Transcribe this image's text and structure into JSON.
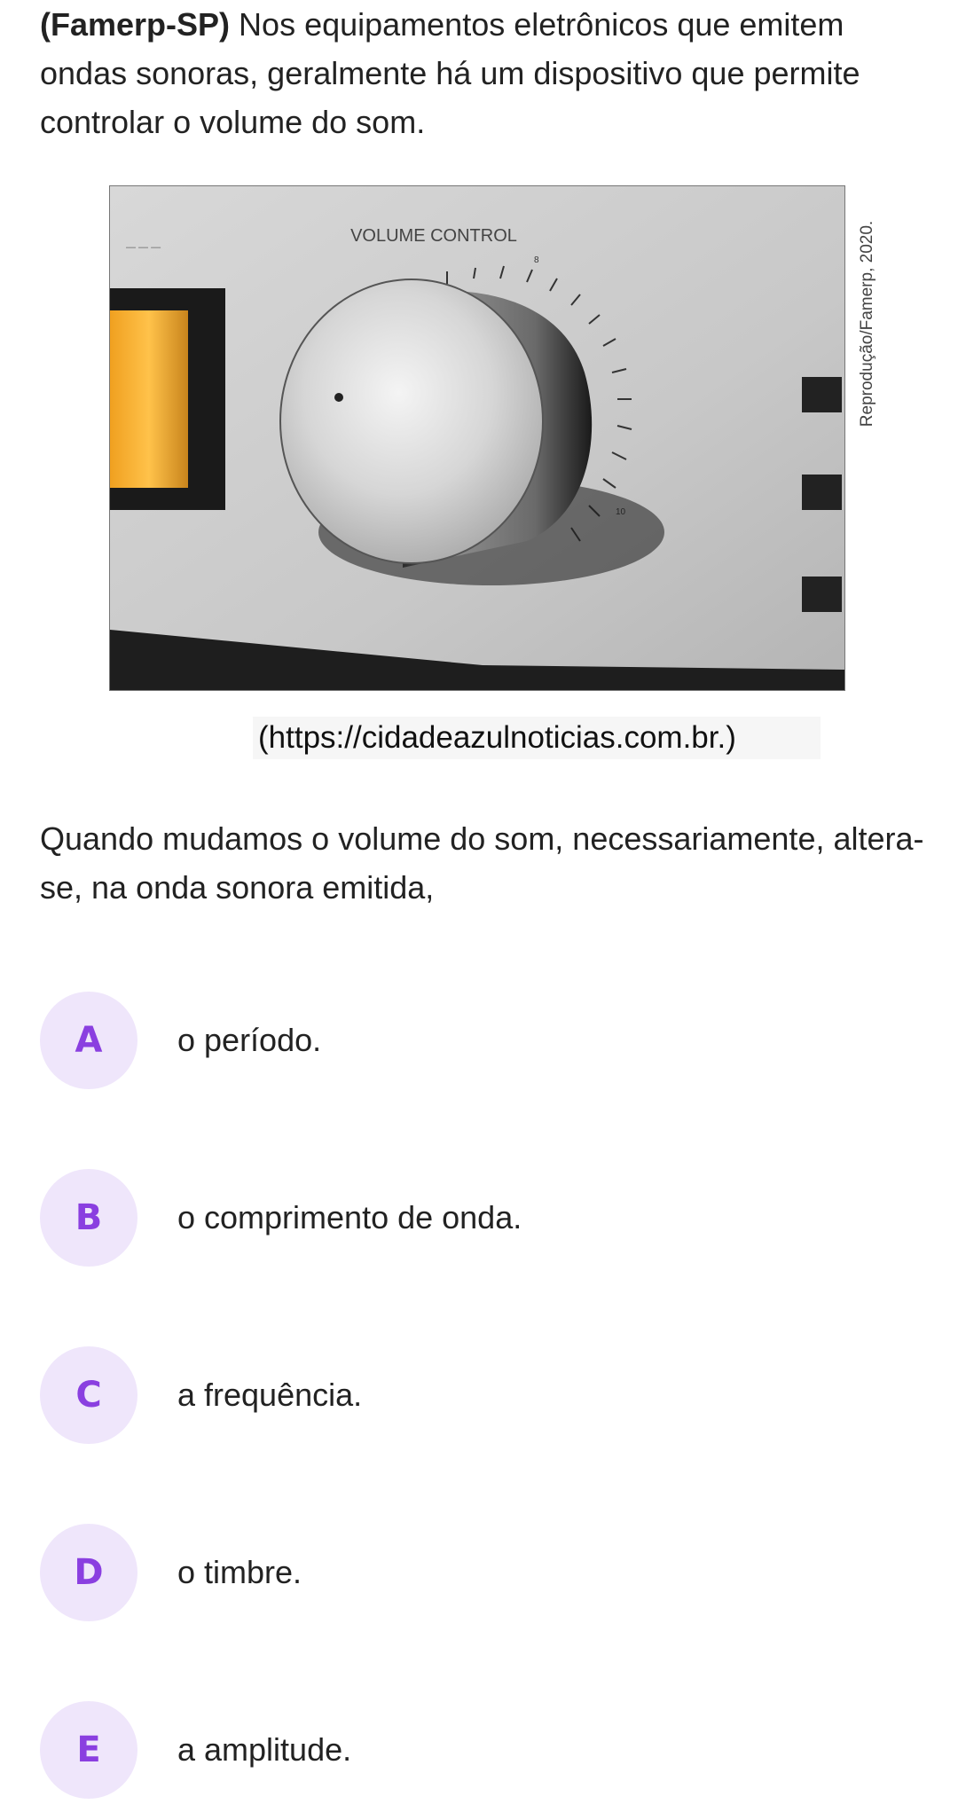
{
  "question": {
    "source_tag": "(Famerp-SP)",
    "intro": "Nos equipamentos eletrônicos que emitem ondas sonoras, geralmente há um dispositivo que permite controlar o volume do som.",
    "stem": "Quando mudamos o volume do som, necessariamente, altera-se, na onda sonora emitida,"
  },
  "figure": {
    "panel_label": "VOLUME CONTROL",
    "credit": "Reprodução/Famerp, 2020.",
    "source": "(https://cidadeazulnoticias.com.br.)"
  },
  "options": [
    {
      "letter": "A",
      "text": "o período."
    },
    {
      "letter": "B",
      "text": "o comprimento de onda."
    },
    {
      "letter": "C",
      "text": "a frequência."
    },
    {
      "letter": "D",
      "text": "o timbre."
    },
    {
      "letter": "E",
      "text": "a amplitude."
    }
  ],
  "colors": {
    "badge_bg": "#efe6fb",
    "badge_letter": "#8a3fe0"
  }
}
